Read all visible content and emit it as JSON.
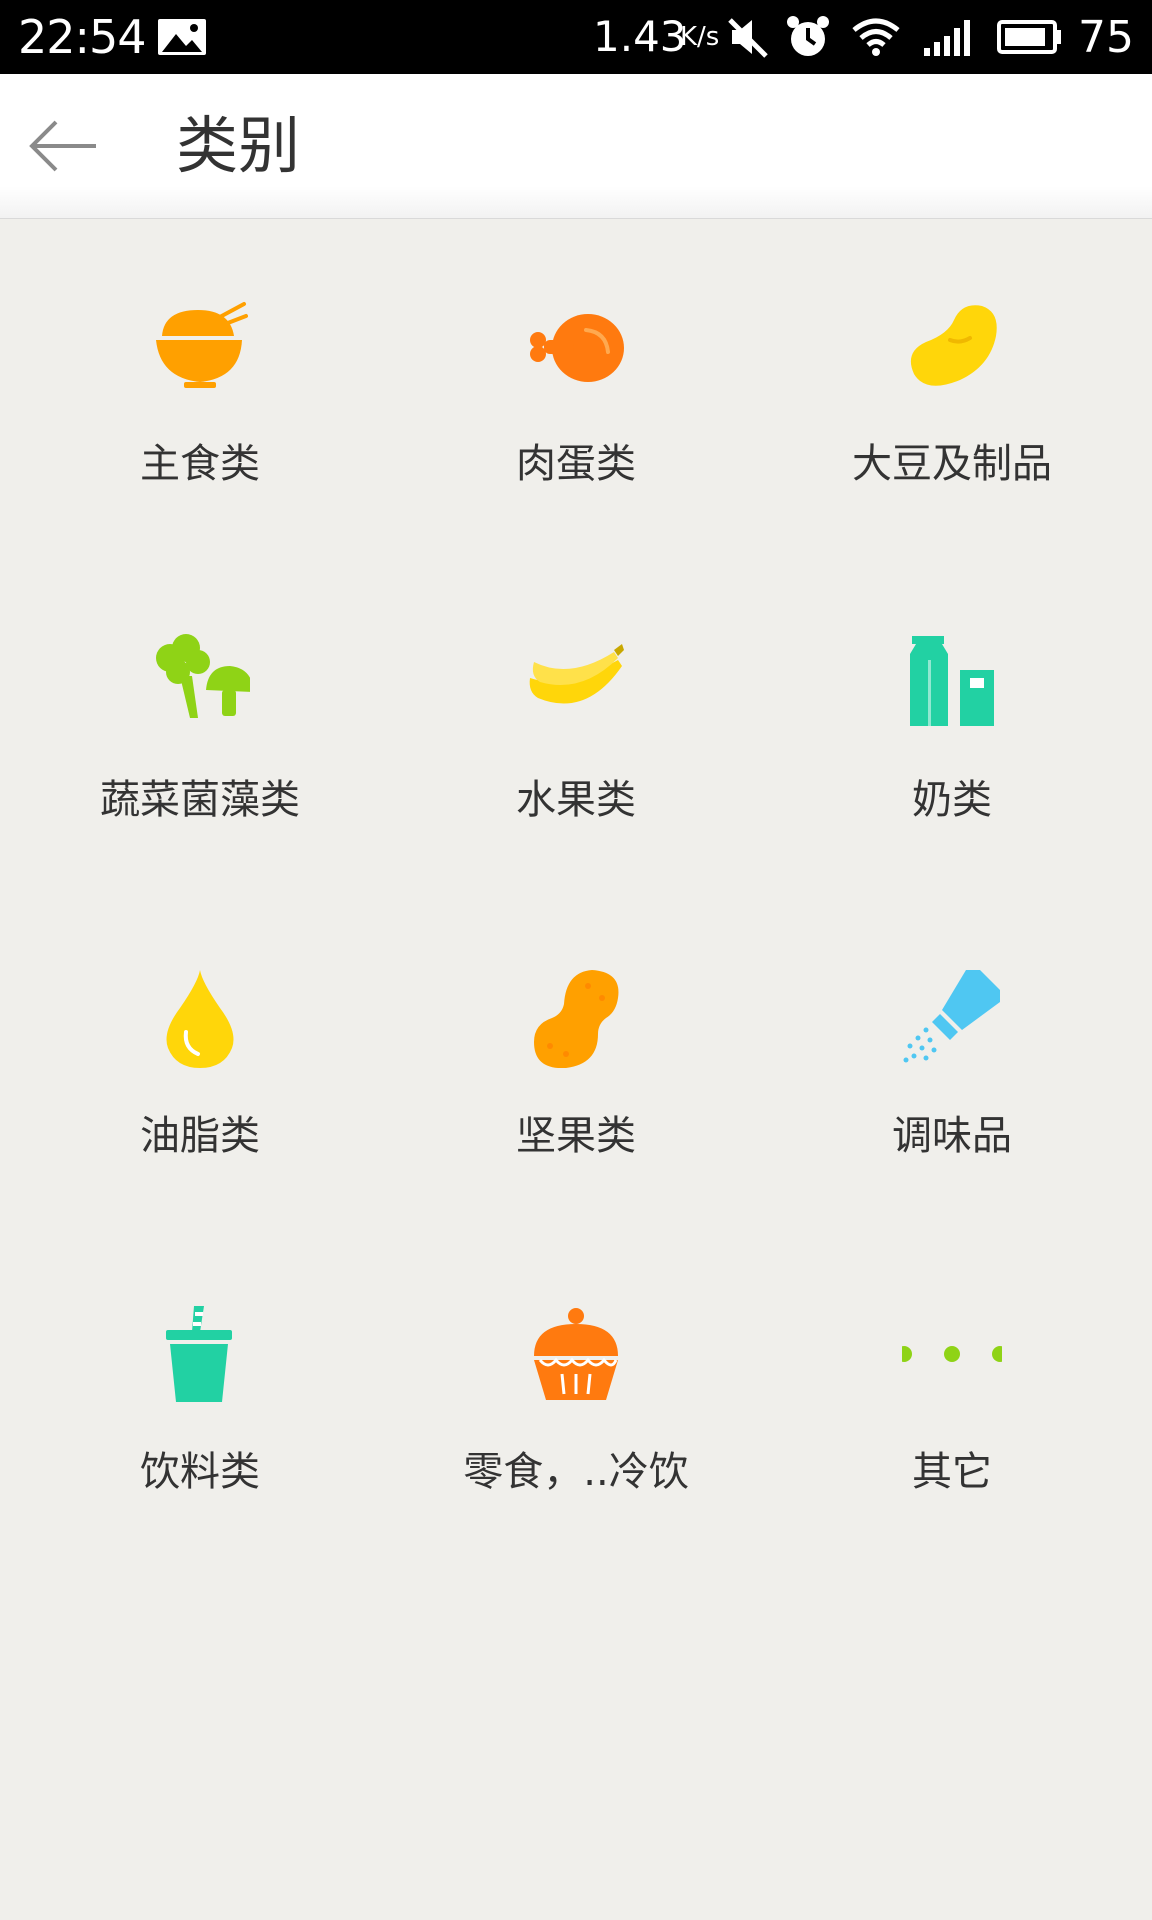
{
  "status_bar": {
    "time": "22:54",
    "net_speed": "1.43",
    "net_speed_unit": "K/s",
    "battery_level": "75",
    "icons": [
      "gallery-icon",
      "mute-icon",
      "alarm-icon",
      "wifi-icon",
      "signal-icon",
      "battery-icon"
    ]
  },
  "header": {
    "back_icon": "arrow-left-icon",
    "title": "类别"
  },
  "categories": [
    {
      "label": "主食类",
      "icon": "rice-bowl-icon",
      "color": "#ffa000"
    },
    {
      "label": "肉蛋类",
      "icon": "chicken-leg-icon",
      "color": "#ff7a0f"
    },
    {
      "label": "大豆及制品",
      "icon": "bean-icon",
      "color": "#ffd60a"
    },
    {
      "label": "蔬菜菌藻类",
      "icon": "broccoli-mushroom-icon",
      "color": "#8fd316"
    },
    {
      "label": "水果类",
      "icon": "banana-icon",
      "color": "#ffd60a"
    },
    {
      "label": "奶类",
      "icon": "milk-carton-icon",
      "color": "#22d1a3"
    },
    {
      "label": "油脂类",
      "icon": "oil-drop-icon",
      "color": "#ffd60a"
    },
    {
      "label": "坚果类",
      "icon": "peanut-icon",
      "color": "#ffa000"
    },
    {
      "label": "调味品",
      "icon": "salt-shaker-icon",
      "color": "#4fc7f2"
    },
    {
      "label": "饮料类",
      "icon": "drink-cup-icon",
      "color": "#22d1a3"
    },
    {
      "label": "零食，..冷饮",
      "icon": "cupcake-icon",
      "color": "#ff7a0f"
    },
    {
      "label": "其它",
      "icon": "more-dots-icon",
      "color": "#8fd316"
    }
  ]
}
